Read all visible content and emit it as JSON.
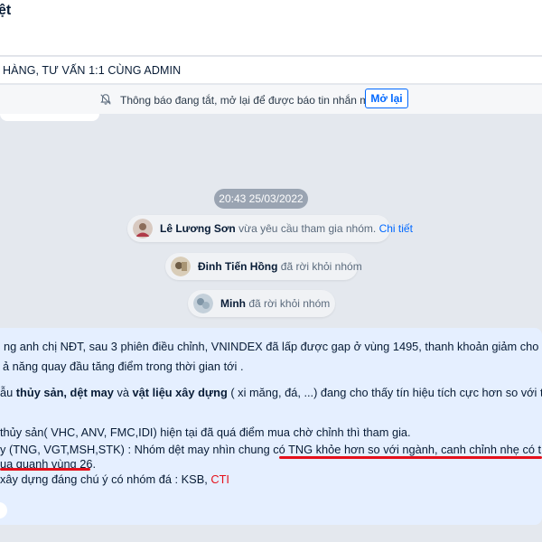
{
  "header": {
    "title": "ệt"
  },
  "banner": {
    "text": "HÀNG, TƯ VẤN 1:1 CÙNG ADMIN"
  },
  "notice": {
    "text": "Thông báo đang tắt, mở lại để được báo tin nhắn mới",
    "button": "Mở lại"
  },
  "timestamp": "20:43 25/03/2022",
  "system_messages": [
    {
      "name": "Lê Lương Sơn",
      "text": "vừa yêu cầu tham gia nhóm.",
      "link": "Chi tiết"
    },
    {
      "name": "Đinh Tiến Hồng",
      "text": "đã rời khỏi nhóm"
    },
    {
      "name": "Minh",
      "text": "đã rời khỏi nhóm"
    }
  ],
  "message": {
    "l1": "ng anh chị NĐT, sau 3 phiên điều chỉnh, VNINDEX đã lấp được gap ở vùng 1495, thanh khoản giảm cho thấy",
    "l2": "ả năng quay đầu tăng điểm trong thời gian tới .",
    "l3a": "ẫu ",
    "l3b": "thủy sản, dệt may",
    "l3c": " và ",
    "l3d": "vật liệu xây dựng",
    "l3e": " ( xi măng, đá, ...) đang cho thấy tín hiệu tích cực hơn so với thị t",
    "l4": "thủy sản( VHC, ANV, FMC,IDI)  hiện tại đã quá điểm mua chờ chỉnh thì tham gia.",
    "l5a": "y (TNG, VGT,MSH,STK) : Nhóm dệt may nhìn chung  có ",
    "l5b": "TNG khỏe hơn so với ngành, canh chỉnh nhẹ có thể t",
    "l6": "ua quanh vùng 26.",
    "l7a": " xây dựng đáng chú ý có nhóm đá : KSB, ",
    "l7b": "CTI"
  },
  "colors": {
    "accent": "#0068ff",
    "highlight": "#e5101b",
    "bubble": "#e5efff"
  }
}
